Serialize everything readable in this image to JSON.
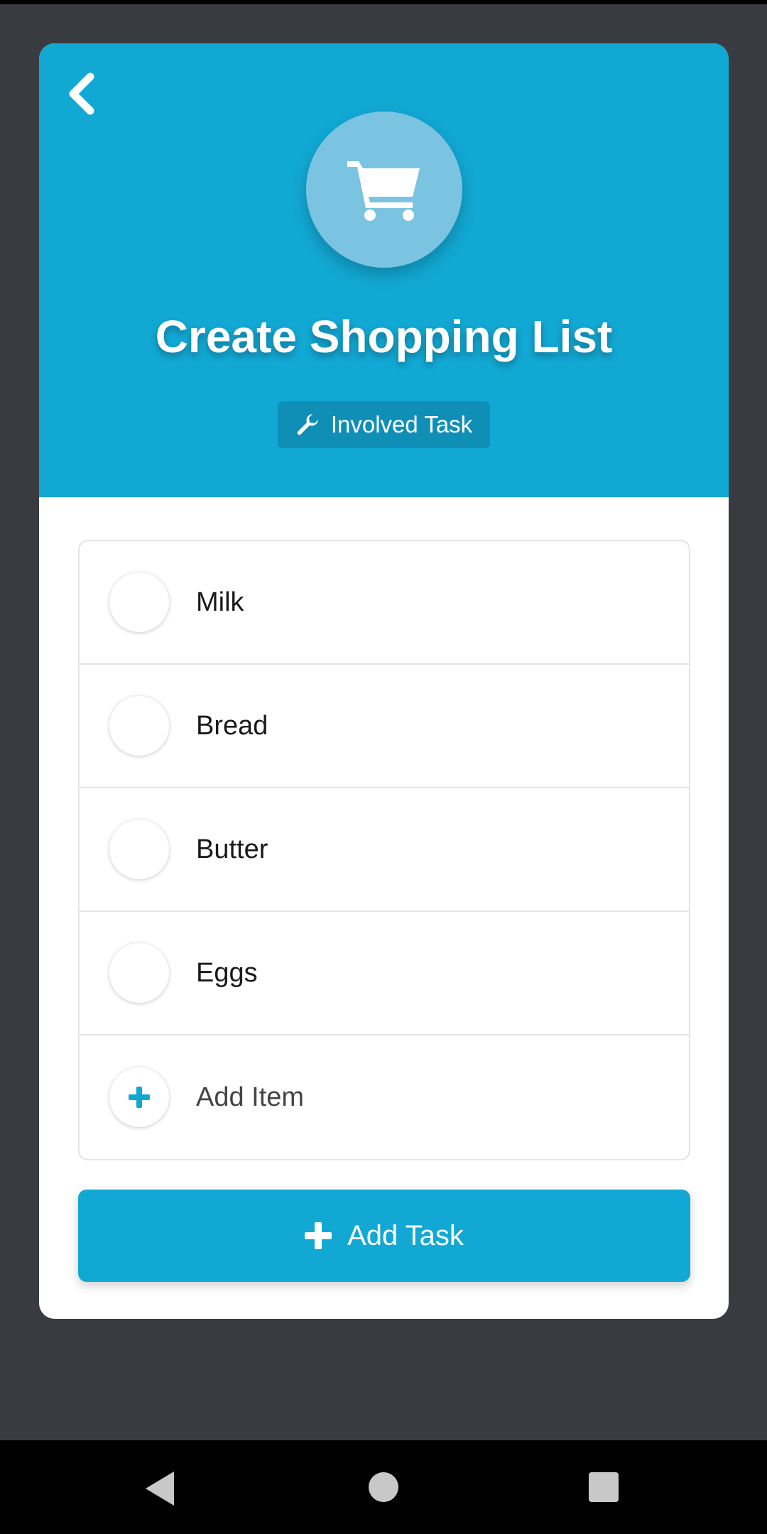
{
  "header": {
    "title": "Create Shopping List",
    "badge_label": "Involved Task",
    "hero_icon": "shopping-cart-icon",
    "back_icon": "chevron-left-icon"
  },
  "items": [
    {
      "label": "Milk"
    },
    {
      "label": "Bread"
    },
    {
      "label": "Butter"
    },
    {
      "label": "Eggs"
    }
  ],
  "add_item": {
    "label": "Add Item",
    "icon": "plus-icon"
  },
  "add_task_button": {
    "label": "Add Task",
    "icon": "plus-icon"
  },
  "colors": {
    "accent": "#12a8d4",
    "badge": "#0f8fb6",
    "background": "#383b3f",
    "hero_circle": "#7ac4e2"
  },
  "nav": {
    "back": "back-triangle-icon",
    "home": "home-circle-icon",
    "recents": "recents-square-icon"
  }
}
